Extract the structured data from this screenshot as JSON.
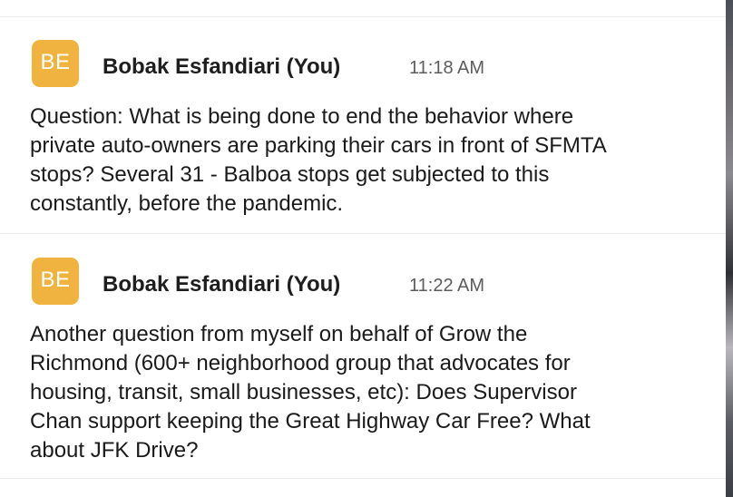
{
  "colors": {
    "avatar_bg": "#F0B33F",
    "avatar_text": "#FFFFFF"
  },
  "messages": [
    {
      "avatar_initials": "BE",
      "sender": "Bobak Esfandiari (You)",
      "time": "11:18 AM",
      "lines": [
        "Question: What is being done to end the behavior where",
        "private auto-owners are parking their cars in front of SFMTA",
        "stops? Several 31 - Balboa stops get subjected to this",
        "constantly, before the pandemic."
      ]
    },
    {
      "avatar_initials": "BE",
      "sender": "Bobak Esfandiari (You)",
      "time": "11:22 AM",
      "lines": [
        "Another question from myself on behalf of Grow the",
        "Richmond (600+ neighborhood group that advocates for",
        "housing, transit, small businesses, etc): Does Supervisor",
        "Chan support keeping the Great Highway Car Free? What",
        "about JFK Drive?"
      ]
    }
  ]
}
